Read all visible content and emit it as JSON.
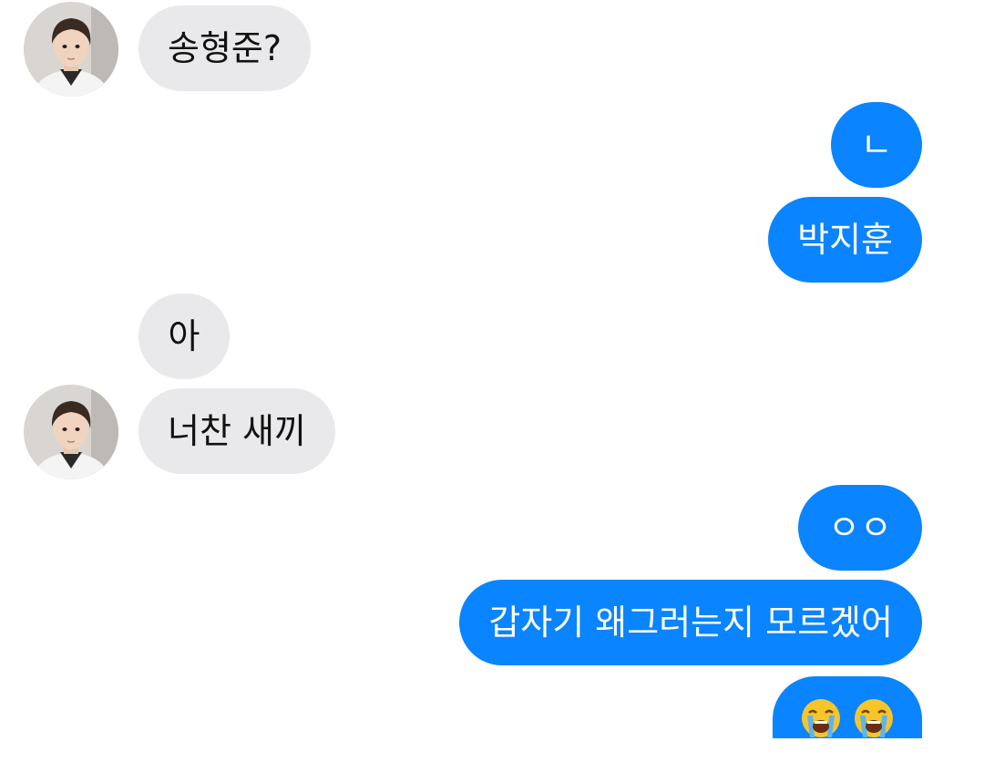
{
  "conversation": {
    "messages": [
      {
        "sender": "other",
        "text": "송형준?",
        "show_avatar": true
      },
      {
        "sender": "me",
        "text": "ㄴ"
      },
      {
        "sender": "me",
        "text": "박지훈"
      },
      {
        "sender": "other",
        "text": "아",
        "show_avatar": false
      },
      {
        "sender": "other",
        "text": "너찬 새끼",
        "show_avatar": true
      },
      {
        "sender": "me",
        "text": "ㅇㅇ"
      },
      {
        "sender": "me",
        "text": "갑자기 왜그러는지 모르겠어"
      },
      {
        "sender": "me",
        "emojis": [
          "loudly-crying-face",
          "loudly-crying-face"
        ]
      }
    ]
  },
  "colors": {
    "incoming_bubble": "#e9e9eb",
    "outgoing_bubble": "#0a84ff",
    "incoming_text": "#111111",
    "outgoing_text": "#ffffff"
  }
}
